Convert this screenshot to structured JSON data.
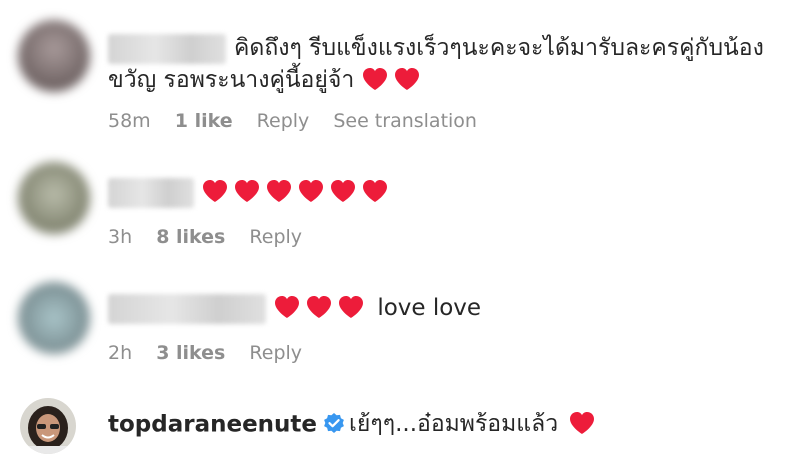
{
  "accent_heart_color": "#ed1c3a",
  "verified_color": "#3897f0",
  "comments": [
    {
      "text_line1": "คิดถึงๆ รีบแข็งแรงเร็วๆนะคะจะได้มารับละครคู่กับน้อง",
      "text_line2": "ขวัญ รอพระนางคู่นี้อยู่จ้า",
      "time": "58m",
      "likes": "1 like",
      "reply": "Reply",
      "translate": "See translation"
    },
    {
      "time": "3h",
      "likes": "8 likes",
      "reply": "Reply"
    },
    {
      "text": "love love",
      "time": "2h",
      "likes": "3 likes",
      "reply": "Reply"
    },
    {
      "username": "topdaraneenute",
      "text": "เย้ๆๆ...อ๋อมพร้อมแล้ว"
    }
  ]
}
